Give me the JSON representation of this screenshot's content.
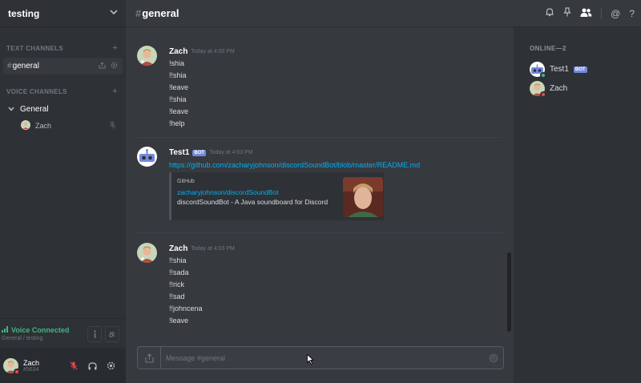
{
  "server": {
    "name": "testing"
  },
  "sidebar": {
    "text_category": "TEXT CHANNELS",
    "voice_category": "VOICE CHANNELS",
    "text_channels": [
      {
        "name": "general"
      }
    ],
    "voice_channels": [
      {
        "name": "General",
        "users": [
          {
            "name": "Zach"
          }
        ]
      }
    ]
  },
  "voice_status": {
    "title": "Voice Connected",
    "subtitle": "General / testing"
  },
  "user": {
    "name": "Zach",
    "tag": "#5634"
  },
  "header": {
    "channel": "general"
  },
  "messages": [
    {
      "author": "Zach",
      "timestamp": "Today at 4:00 PM",
      "lines": [
        "!shia",
        "!!shia",
        "!leave",
        "!!shia",
        "!leave",
        "!help"
      ]
    },
    {
      "author": "Test1",
      "bot_tag": "BOT",
      "timestamp": "Today at 4:03 PM",
      "link": "https://github.com/zacharyjohnson/discordSoundBot/blob/master/README.md",
      "embed": {
        "provider": "GitHub",
        "title": "zacharyjohnson/discordSoundBot",
        "description": "discordSoundBot - A Java soundboard for Discord"
      }
    },
    {
      "author": "Zach",
      "timestamp": "Today at 4:03 PM",
      "lines": [
        "!!shia",
        "!!sada",
        "!!rick",
        "!!sad",
        "!!johncena",
        "!leave"
      ]
    }
  ],
  "composer": {
    "placeholder": "Message #general"
  },
  "members": {
    "header": "ONLINE—2",
    "list": [
      {
        "name": "Test1",
        "bot_tag": "BOT",
        "status_color": "#43b581"
      },
      {
        "name": "Zach",
        "status_color": "#f04747"
      }
    ]
  },
  "colors": {
    "accent": "#7289da",
    "link": "#00b0f4",
    "online": "#43b581",
    "dnd": "#f04747"
  }
}
